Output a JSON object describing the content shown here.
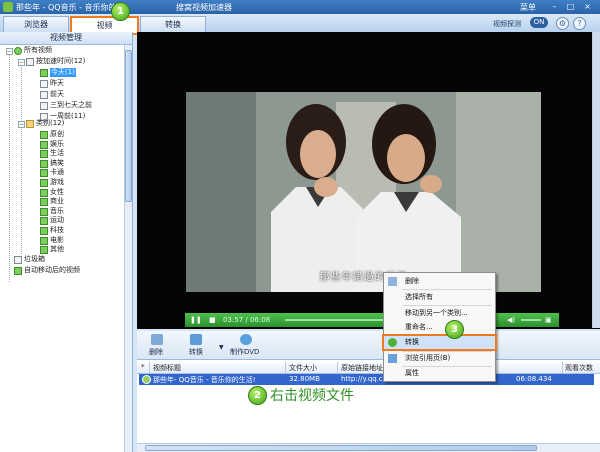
{
  "titlebar": {
    "title": "那些年 - QQ音乐 - 音乐你的",
    "title_suffix": "搜窝视频加速器",
    "menu_label": "菜单"
  },
  "tabs": [
    {
      "label": "浏览器"
    },
    {
      "label": "视频",
      "active": true
    },
    {
      "label": "转换"
    }
  ],
  "header_right": {
    "sniff_label": "视频探测",
    "toggle": "ON"
  },
  "left_panel": {
    "title": "视频管理",
    "tree": {
      "root": "所有视频",
      "by_time": "按加速时间(12)",
      "time_items": [
        "今天(1)",
        "昨天",
        "前天",
        "三到七天之前",
        "一周前(11)"
      ],
      "category": "类别(12)",
      "category_items": [
        "原创",
        "娱乐",
        "生活",
        "搞笑",
        "卡通",
        "游戏",
        "女性",
        "商业",
        "音乐",
        "运动",
        "科技",
        "电影",
        "其他"
      ],
      "trash": "垃圾箱",
      "auto_moved": "自动移动后的视频"
    }
  },
  "player": {
    "subtitle": "那些年錯過的愛情",
    "time": "03:57 / 06:08"
  },
  "toolbar": {
    "delete": "删除",
    "convert": "转换",
    "make_dvd": "制作DVD"
  },
  "list": {
    "columns": [
      "视频标题",
      "文件大小",
      "原始链接地址",
      "观看次数"
    ],
    "rows": [
      {
        "title": "那些年- QQ音乐 - 音乐你的生活!",
        "size": "32.80MB",
        "url": "http://y.qq.c",
        "time": "06:08.434"
      }
    ]
  },
  "context_menu": {
    "items": [
      "删除",
      "选择所有",
      "移动到另一个类别...",
      "重命名...",
      "转换",
      "浏览引用页(B)",
      "属性"
    ],
    "selected_index": 4
  },
  "annotations": {
    "step1": "1",
    "step2": "2",
    "step3": "3",
    "step2_text": "右击视频文件"
  }
}
